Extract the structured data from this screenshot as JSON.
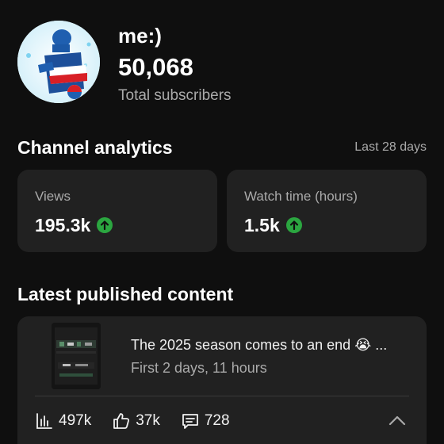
{
  "header": {
    "channel_name": "me:)",
    "subscriber_count": "50,068",
    "subscriber_label": "Total subscribers",
    "avatar_logo_text": "PEPSI"
  },
  "analytics": {
    "title": "Channel analytics",
    "period": "Last 28 days",
    "cards": [
      {
        "label": "Views",
        "value": "195.3k",
        "trend_icon": "arrow-up-circle-icon"
      },
      {
        "label": "Watch time (hours)",
        "value": "1.5k",
        "trend_icon": "arrow-up-circle-icon"
      }
    ]
  },
  "latest": {
    "title": "Latest published content",
    "video": {
      "title": "The 2025 season comes to an end 😭 ...",
      "meta": "First 2 days, 11 hours",
      "stats": {
        "views": "497k",
        "likes": "37k",
        "comments": "728"
      }
    }
  },
  "colors": {
    "background": "#0f0f0f",
    "card": "#212121",
    "trend_up": "#2ba640",
    "muted_text": "#aaaaaa"
  }
}
